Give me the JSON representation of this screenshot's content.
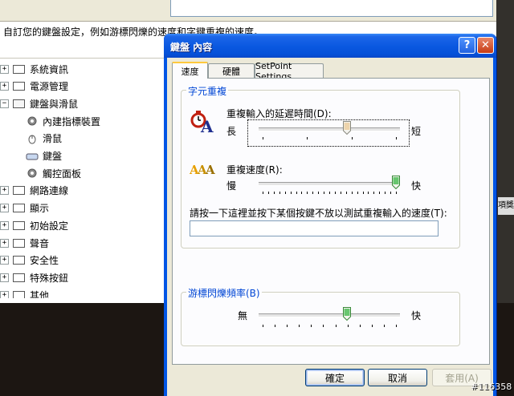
{
  "background_window": {
    "description": "自訂您的鍵盤設定，例如游標閃爍的速度和字鍵重複的速度。",
    "tree": [
      {
        "label": "系統資訊",
        "expander": "+"
      },
      {
        "label": "電源管理",
        "expander": "+"
      },
      {
        "label": "鍵盤與滑鼠",
        "expander": "−"
      },
      {
        "label": "內建指標裝置"
      },
      {
        "label": "滑鼠"
      },
      {
        "label": "鍵盤"
      },
      {
        "label": "觸控面板"
      },
      {
        "label": "網路連線",
        "expander": "+"
      },
      {
        "label": "顯示",
        "expander": "+"
      },
      {
        "label": "初始設定",
        "expander": "+"
      },
      {
        "label": "聲音",
        "expander": "+"
      },
      {
        "label": "安全性",
        "expander": "+"
      },
      {
        "label": "特殊按鈕",
        "expander": "+"
      },
      {
        "label": "其他",
        "expander": "+"
      }
    ],
    "side_text": "項獎"
  },
  "dialog": {
    "title": "鍵盤 內容",
    "help_symbol": "?",
    "close_symbol": "✕",
    "tabs": [
      "速度",
      "硬體",
      "SetPoint Settings"
    ],
    "active_tab": "速度",
    "character_repeat": {
      "group_title": "字元重複",
      "delay": {
        "label": "重複輸入的延遲時間(D):",
        "left": "長",
        "right": "短",
        "position_fraction": 0.63
      },
      "rate": {
        "label": "重複速度(R):",
        "left": "慢",
        "right": "快",
        "position_fraction": 1.0
      },
      "test_label": "請按一下這裡並按下某個按鍵不放以測試重複輸入的速度(T):",
      "test_value": ""
    },
    "cursor_blink": {
      "group_title": "游標閃爍頻率(B)",
      "left": "無",
      "right": "快",
      "position_fraction": 0.63
    },
    "buttons": {
      "ok": "確定",
      "cancel": "取消",
      "apply": "套用(A)"
    }
  },
  "watermark": "#116358",
  "colors": {
    "title_bar": "#0a58e0",
    "tab_highlight": "#ffc83c",
    "group_title": "#0046d5",
    "slider_thumb": "#68c66f"
  }
}
